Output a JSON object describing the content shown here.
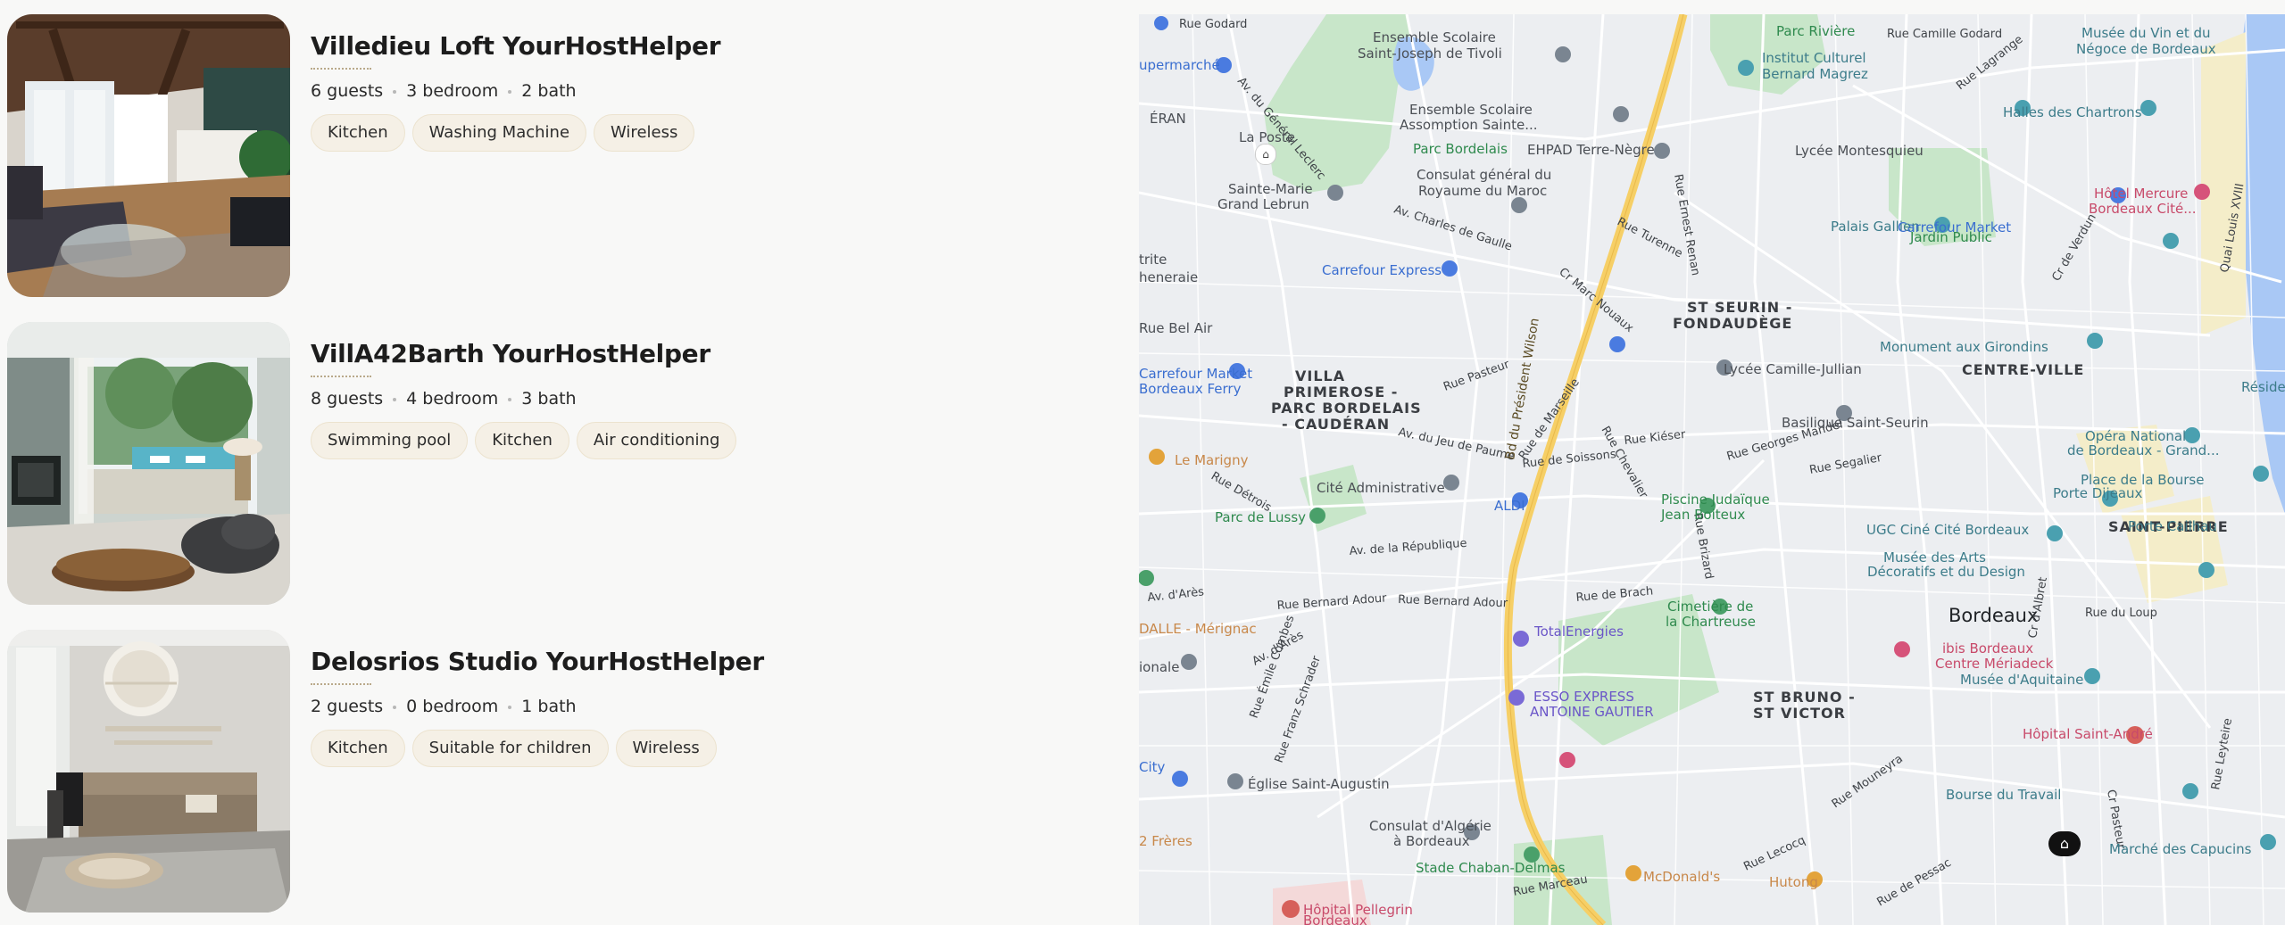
{
  "listings": [
    {
      "title": "Villedieu Loft YourHostHelper",
      "guests": "6 guests",
      "bedrooms": "3 bedroom",
      "baths": "2 bath",
      "amenities": [
        "Kitchen",
        "Washing Machine",
        "Wireless"
      ]
    },
    {
      "title": "VillA42Barth YourHostHelper",
      "guests": "8 guests",
      "bedrooms": "4 bedroom",
      "baths": "3 bath",
      "amenities": [
        "Swimming pool",
        "Kitchen",
        "Air conditioning"
      ]
    },
    {
      "title": "Delosrios Studio YourHostHelper",
      "guests": "2 guests",
      "bedrooms": "0 bedroom",
      "baths": "1 bath",
      "amenities": [
        "Kitchen",
        "Suitable for children",
        "Wireless"
      ]
    }
  ],
  "map": {
    "city_label": "Bordeaux",
    "districts": {
      "st_seurin": "ST SEURIN -",
      "fondaudege": "FONDAUDÈGE",
      "centre_ville": "CENTRE-VILLE",
      "villa_primerose_1": "VILLA",
      "villa_primerose_2": "PRIMEROSE -",
      "villa_primerose_3": "PARC BORDELAIS",
      "villa_primerose_4": "- CAUDÉRAN",
      "saint_pierre": "SAINT-PIERRE",
      "st_bruno_1": "ST BRUNO -",
      "st_bruno_2": "ST VICTOR"
    },
    "streets": {
      "bd_president_wilson": "Bd du Président Wilson",
      "rue_godard": "Rue Godard",
      "rue_camille_godard": "Rue Camille Godard",
      "rue_lagrange": "Rue Lagrange",
      "rue_turenne": "Rue Turenne",
      "rue_ernest_renan": "Rue Ernest Renan",
      "rue_pasteur": "Rue Pasteur",
      "rue_de_marseille": "Rue de Marseille",
      "rue_chevalier": "Rue Chevalier",
      "rue_georges_mandel": "Rue Georges Mandel",
      "av_charles_de_gaulle": "Av. Charles de Gaulle",
      "av_de_la_republique": "Av. de la République",
      "av_d_ares": "Av. d'Arès",
      "av_d_ares_2": "Av. d'Arès",
      "rue_bernard_adour": "Rue Bernard Adour",
      "rue_bernard_adour_2": "Rue Bernard Adour",
      "rue_de_brach": "Rue de Brach",
      "rue_brizard": "Rue Brizard",
      "rue_mouneyra": "Rue Mouneyra",
      "rue_emile_combes": "Rue Émile Combes",
      "rue_franz_schrader": "Rue Franz Schrader",
      "av_du_general_leclerc": "Av. du Général Leclerc",
      "quai_louis_xviii": "Quai Louis XVIII",
      "rue_marceau": "Rue Marceau",
      "rue_de_soissons": "Rue de Soissons",
      "rue_kieser": "Rue Kiéser",
      "rue_segalier": "Rue Segalier",
      "cr_marc_nouaux": "Cr Marc Nouaux",
      "rue_detrois": "Rue Détrois",
      "av_du_jeu_de_paume": "Av. du Jeu de Paume",
      "rue_lecocq": "Rue Lecocq",
      "rue_de_pessac": "Rue de Pessac",
      "cr_de_verdun": "Cr de Verdun",
      "cr_d_albret": "Cr d'Albret",
      "cr_pasteur": "Cr Pasteur",
      "rue_leyteire": "Rue Leyteire",
      "rue_du_loup": "Rue du Loup"
    },
    "pois": {
      "parc_riviere": "Parc Rivière",
      "institut_culturel_1": "Institut Culturel",
      "institut_culturel_2": "Bernard Magrez",
      "musee_vin_1": "Musée du Vin et du",
      "musee_vin_2": "Négoce de Bordeaux",
      "halles_chartrons": "Halles des Chartrons",
      "ensemble_scolaire_1a": "Ensemble Scolaire",
      "ensemble_scolaire_1b": "Saint-Joseph de Tivoli",
      "ensemble_scolaire_2a": "Ensemble Scolaire",
      "ensemble_scolaire_2b": "Assomption Sainte...",
      "parc_bordelais": "Parc Bordelais",
      "ehpad": "EHPAD Terre-Nègre",
      "lycee_montesquieu": "Lycée Montesquieu",
      "consulat_maroc_1": "Consulat général du",
      "consulat_maroc_2": "Royaume du Maroc",
      "hotel_mercure_1": "Hôtel Mercure",
      "hotel_mercure_2": "Bordeaux Cité...",
      "sainte_marie_1": "Sainte-Marie",
      "sainte_marie_2": "Grand Lebrun",
      "carrefour_market_1": "Carrefour Market",
      "jardin_public": "Jardin Public",
      "palais_gallien": "Palais Gallien",
      "carrefour_express_1": "Carrefour Express",
      "monument_girondins": "Monument aux Girondins",
      "lycee_camille_jullian": "Lycée Camille-Jullian",
      "carrefour_market_2a": "Carrefour Market",
      "carrefour_market_2b": "Bordeaux Ferry",
      "basilique": "Basilique Saint-Seurin",
      "le_marigny": "Le Marigny",
      "opera_1": "Opéra National",
      "opera_2": "de Bordeaux - Grand...",
      "porte_dijeaux": "Porte Dijeaux",
      "place_bourse": "Place de la Bourse",
      "cite_administrative": "Cité Administrative",
      "aldi": "ALDI",
      "piscine_1": "Piscine Judaïque",
      "piscine_2": "Jean Boiteux",
      "parc_de_lussy": "Parc de Lussy",
      "ugc": "UGC Ciné Cité Bordeaux",
      "porte_cailhau": "Porte Cailhau",
      "musee_arts_1": "Musée des Arts",
      "musee_arts_2": "Décoratifs et du Design",
      "cimetiere_1": "Cimetière de",
      "cimetiere_2": "la Chartreuse",
      "dalle_merignac": "DALLE - Mérignac",
      "totalenergies": "TotalEnergies",
      "ibis_1": "ibis Bordeaux",
      "ibis_2": "Centre Mériadeck",
      "musee_aquitaine": "Musée d'Aquitaine",
      "esso_1": "ESSO EXPRESS",
      "esso_2": "ANTOINE GAUTIER",
      "hopital_saint_andre": "Hôpital Saint-André",
      "eglise_saint_augustin": "Église Saint-Augustin",
      "bourse_travail": "Bourse du Travail",
      "consulat_algerie_1": "Consulat d'Algérie",
      "consulat_algerie_2": "à Bordeaux",
      "stade_chaban": "Stade Chaban-Delmas",
      "mcdonalds": "McDonald's",
      "hutong": "Hutong",
      "marche_capucins": "Marché des Capucins",
      "hopital_pellegrin_1": "Hôpital Pellegrin",
      "hopital_pellegrin_2": "Bordeaux",
      "la_poste": "La Poste",
      "residence": "Résidence",
      "eran": "ÉRAN",
      "upermarche": "upermarché",
      "trite": "trite",
      "heneraie": "heneraie",
      "rue_bel_air": "Rue Bel Air",
      "rue_tourte": "ionale",
      "city": "City",
      "freres": "2 Frères"
    },
    "colors": {
      "park": "#c8e6c9",
      "water": "#a9c8f5",
      "highway": "#f6cf66",
      "road": "#ffffff",
      "block": "#eceef1"
    }
  }
}
